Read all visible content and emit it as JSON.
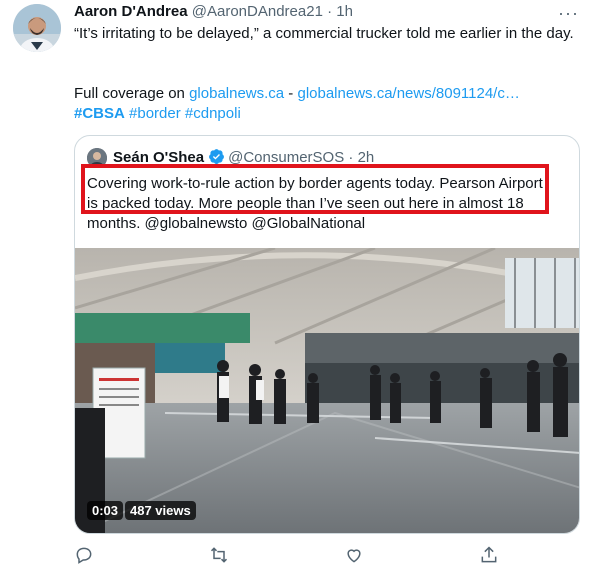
{
  "tweet": {
    "author_name": "Aaron D'Andrea",
    "author_handle": "@AaronDAndrea21",
    "separator": "·",
    "time": "1h",
    "text_line1": "“It’s irritating to be delayed,” a commercial trucker told me earlier in the day.",
    "coverage_prefix": "Full coverage on ",
    "coverage_link1": "globalnews.ca",
    "coverage_dash": " - ",
    "coverage_link2": "globalnews.ca/news/8091124/c…",
    "hashtags": [
      "#CBSA",
      "#border",
      "#cdnpoli"
    ]
  },
  "quote": {
    "author_name": "Seán O'Shea",
    "author_handle": "@ConsumerSOS",
    "separator": "·",
    "time": "2h",
    "text": "Covering work-to-rule action by border agents today. Pearson Airport is packed today. More people than I’ve seen out here in almost 18 months. @globalnewsto @GlobalNational",
    "video_timer": "0:03",
    "video_views": "487 views"
  },
  "actions": [
    {
      "name": "reply-icon"
    },
    {
      "name": "retweet-icon"
    },
    {
      "name": "like-icon"
    },
    {
      "name": "share-icon"
    }
  ],
  "colors": {
    "link": "#1d9bf0",
    "highlight_box": "#e0141c",
    "verified": "#1d9bf0",
    "secondary_text": "#536471"
  }
}
